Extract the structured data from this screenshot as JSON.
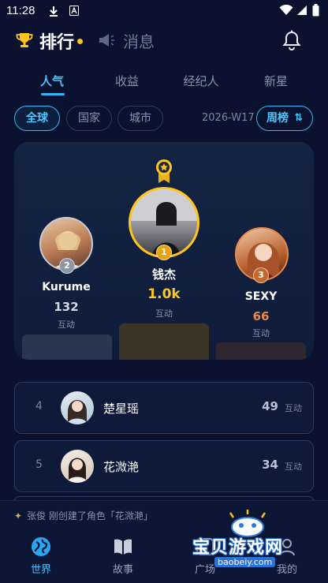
{
  "status_bar": {
    "time": "11:28"
  },
  "header": {
    "rank_title": "排行",
    "messages_title": "消息"
  },
  "tabs": [
    {
      "label": "人气",
      "active": true
    },
    {
      "label": "收益",
      "active": false
    },
    {
      "label": "经纪人",
      "active": false
    },
    {
      "label": "新星",
      "active": false
    }
  ],
  "filters": {
    "scope": [
      {
        "label": "全球",
        "active": true
      },
      {
        "label": "国家",
        "active": false
      },
      {
        "label": "城市",
        "active": false
      }
    ],
    "week": "2026-W17",
    "period_label": "周榜"
  },
  "podium": [
    {
      "rank": "1",
      "name": "钱杰",
      "score": "1.0k",
      "unit": "互动"
    },
    {
      "rank": "2",
      "name": "Kurume",
      "score": "132",
      "unit": "互动"
    },
    {
      "rank": "3",
      "name": "SEXY",
      "score": "66",
      "unit": "互动"
    }
  ],
  "list": [
    {
      "rank": "4",
      "name": "楚星瑶",
      "score": "49",
      "unit": "互动"
    },
    {
      "rank": "5",
      "name": "花溦滟",
      "score": "34",
      "unit": "互动"
    }
  ],
  "activity_text": "张俊 刚创建了角色「花溦滟」",
  "nav": [
    {
      "label": "世界",
      "icon": "globe-icon",
      "active": true
    },
    {
      "label": "故事",
      "icon": "book-icon",
      "active": false
    },
    {
      "label": "广场",
      "icon": "square-icon",
      "active": false
    },
    {
      "label": "我的",
      "icon": "profile-icon",
      "active": false
    }
  ],
  "watermark": {
    "text": "宝贝游戏网",
    "url": "baobeiy.com"
  },
  "colors": {
    "accent": "#45c4ff",
    "gold": "#ffc61a",
    "bronze": "#e98a4a",
    "background": "#0a1230"
  }
}
